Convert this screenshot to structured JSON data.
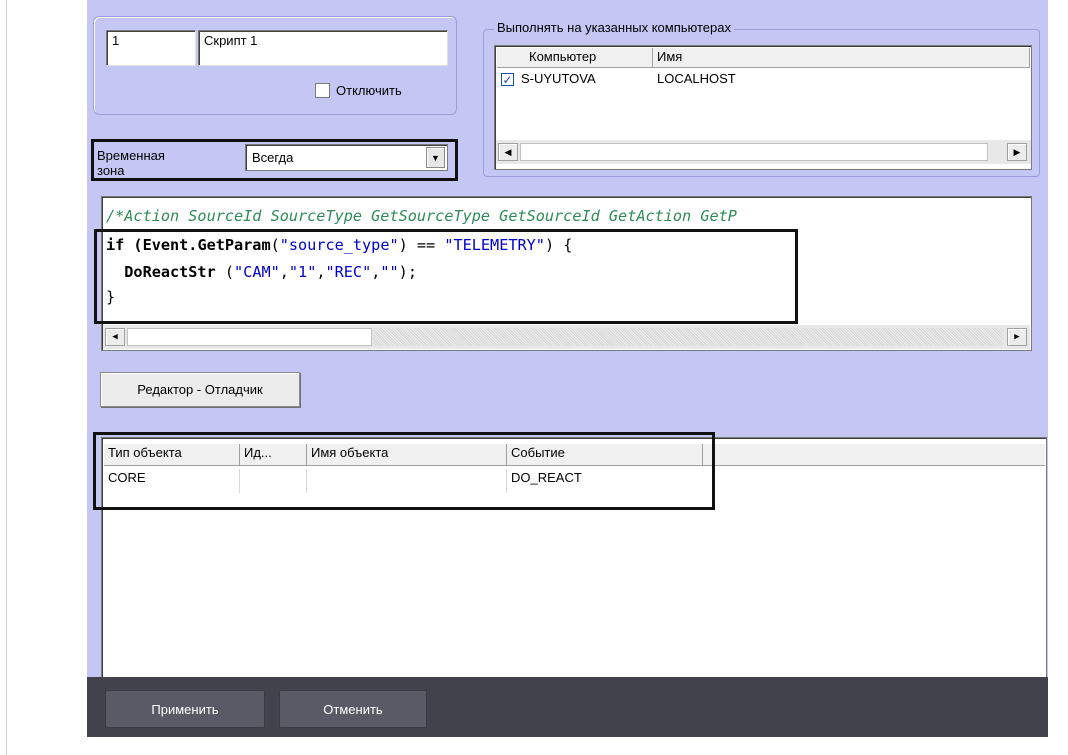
{
  "script": {
    "number": "1",
    "name": "Скрипт 1",
    "disable_label": "Отключить"
  },
  "computers": {
    "group_title": "Выполнять на указанных компьютерах",
    "columns": [
      "Компьютер",
      "Имя"
    ],
    "rows": [
      {
        "checked": true,
        "computer": "S-UYUTOVA",
        "name": "LOCALHOST"
      }
    ]
  },
  "timezone": {
    "label": "Временная зона",
    "value": "Всегда"
  },
  "code": {
    "line1": "/*Action SourceId SourceType GetSourceType GetSourceId GetAction GetP",
    "line2_kw": "if (",
    "line2_fn": "Event.GetParam",
    "line2_a": "(",
    "line2_s1": "\"source_type\"",
    "line2_b": ") == ",
    "line2_s2": "\"TELEMETRY\"",
    "line2_c": ") {",
    "line3_fn": "  DoReactStr",
    "line3_a": " (",
    "line3_s1": "\"CAM\"",
    "line3_c1": ",",
    "line3_s2": "\"1\"",
    "line3_c2": ",",
    "line3_s3": "\"REC\"",
    "line3_c3": ",",
    "line3_s4": "\"\"",
    "line3_end": ");",
    "line4": "}"
  },
  "debugger_button": "Редактор - Отладчик",
  "objects": {
    "columns": [
      "Тип объекта",
      "Ид...",
      "Имя объекта",
      "Событие"
    ],
    "rows": [
      {
        "type": "CORE",
        "id": "",
        "name": "",
        "event": "DO_REACT"
      }
    ]
  },
  "footer": {
    "apply": "Применить",
    "cancel": "Отменить"
  },
  "colors": {
    "panel": "#c4c6f4",
    "footer": "#42424c",
    "comment": "#2e8b57",
    "string": "#0000cc"
  }
}
